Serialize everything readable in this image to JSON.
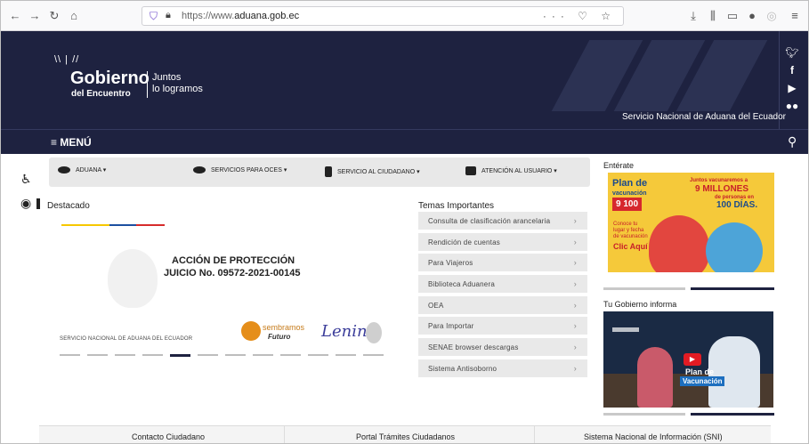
{
  "browser": {
    "url_prefix": "https://www.",
    "url_domain": "aduana.gob.ec",
    "url_suffix": "",
    "url_actions": "··· ♡ ☆"
  },
  "header": {
    "logo_main": "Gobierno",
    "logo_sub": "del Encuentro",
    "slogan_line1": "Juntos",
    "slogan_line2": "lo logramos",
    "agency": "Servicio Nacional de Aduana del Ecuador",
    "menu_label": "≡ MENÚ"
  },
  "nav": {
    "items": [
      "ADUANA ▾",
      "SERVICIOS PARA OCES ▾",
      "SERVICIO AL CIUDADANO ▾",
      "ATENCIÓN AL USUARIO ▾"
    ]
  },
  "destacado": {
    "heading": "Destacado",
    "title": "ACCIÓN DE PROTECCIÓN",
    "subtitle": "JUICIO No. 09572-2021-00145",
    "footer_text": "SERVICIO NACIONAL DE ADUANA DEL ECUADOR",
    "sembramos": "sembramos",
    "futuro": "Futuro",
    "lenin": "Lenin",
    "slide_count": 12,
    "active_slide": 5
  },
  "temas": {
    "heading": "Temas Importantes",
    "items": [
      "Consulta de clasificación arancelaria",
      "Rendición de cuentas",
      "Para Viajeros",
      "Biblioteca Aduanera",
      "OEA",
      "Para Importar",
      "SENAE browser descargas",
      "Sistema Antisoborno"
    ]
  },
  "right": {
    "enterate": "Entérate",
    "plan_title": "Plan de",
    "plan_sub": "vacunación",
    "plan_num": "9 100",
    "juntos": "Juntos vacunaremos a",
    "millones": "9 MILLONES",
    "personas": "de personas en",
    "dias": "100 DÍAS.",
    "conoce": "Conoce tu lugar y fecha de vacunación",
    "clic": "Clic Aquí",
    "tu_gobierno": "Tu Gobierno informa",
    "video_plan": "Plan de",
    "video_vac": "Vacunación"
  },
  "footer": {
    "links": [
      "Contacto Ciudadano",
      "Portal Trámites Ciudadanos",
      "Sistema Nacional de Información (SNI)"
    ]
  },
  "colors": {
    "header_bg": "#1e2240",
    "accent_red": "#d6272d",
    "flag_yellow": "#f6c700",
    "flag_blue": "#1d4fa0",
    "flag_red": "#d62c2c"
  }
}
